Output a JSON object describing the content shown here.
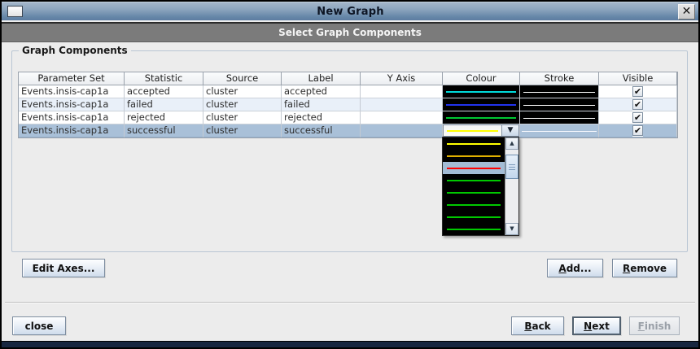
{
  "window": {
    "title": "New Graph"
  },
  "step_header": "Select Graph Components",
  "group": {
    "title": "Graph Components"
  },
  "table": {
    "columns": [
      "Parameter Set",
      "Statistic",
      "Source",
      "Label",
      "Y Axis",
      "Colour",
      "Stroke",
      "Visible"
    ],
    "rows": [
      {
        "parameter_set": "Events.insis-cap1a",
        "statistic": "accepted",
        "source": "cluster",
        "label": "accepted",
        "y_axis": "",
        "colour": "#00dcdc",
        "stroke_color": "#ffffff",
        "visible": true
      },
      {
        "parameter_set": "Events.insis-cap1a",
        "statistic": "failed",
        "source": "cluster",
        "label": "failed",
        "y_axis": "",
        "colour": "#2233ee",
        "stroke_color": "#ffffff",
        "visible": true
      },
      {
        "parameter_set": "Events.insis-cap1a",
        "statistic": "rejected",
        "source": "cluster",
        "label": "rejected",
        "y_axis": "",
        "colour": "#00c832",
        "stroke_color": "#ffffff",
        "visible": true
      },
      {
        "parameter_set": "Events.insis-cap1a",
        "statistic": "successful",
        "source": "cluster",
        "label": "successful",
        "y_axis": "",
        "colour": "#ffff00",
        "stroke_color": "#f8f9ff",
        "visible": true
      }
    ],
    "selected_row_index": 3
  },
  "colour_combo": {
    "editor_color": "#ffff00"
  },
  "colour_dropdown": {
    "items": [
      {
        "color": "#ffff00",
        "selected": false
      },
      {
        "color": "#e0b000",
        "selected": false
      },
      {
        "color": "#ff0000",
        "selected": true
      },
      {
        "color": "#00c800",
        "selected": false
      },
      {
        "color": "#00c800",
        "selected": false
      },
      {
        "color": "#00c800",
        "selected": false
      },
      {
        "color": "#00c800",
        "selected": false
      },
      {
        "color": "#00c800",
        "selected": false
      }
    ]
  },
  "buttons": {
    "edit_axes": {
      "label": "Edit Axes..."
    },
    "add": {
      "mnemonic": "A",
      "rest": "dd..."
    },
    "remove": {
      "mnemonic": "R",
      "rest": "emove"
    },
    "close": {
      "label": "close"
    },
    "back": {
      "mnemonic": "B",
      "rest": "ack"
    },
    "next": {
      "mnemonic": "N",
      "rest": "ext"
    },
    "finish": {
      "mnemonic": "F",
      "rest": "inish"
    }
  },
  "icons": {
    "close": "✕",
    "check": "✔",
    "combo_arrow": "▼",
    "scroll_up": "▲",
    "scroll_down": "▼"
  },
  "colors": {
    "titlebar_top": "#a3b6ca",
    "titlebar_bottom": "#5c7da1",
    "step_header_bg": "#7b7b7b",
    "panel_bg": "#ececec",
    "selected_row_bg": "#a9c0d8",
    "alt_row_bg": "#e9f0f9",
    "dropdown_selection_bg": "#a3bcd5",
    "swatch_bg": "#000000",
    "bottom_strip": "#17263f"
  }
}
